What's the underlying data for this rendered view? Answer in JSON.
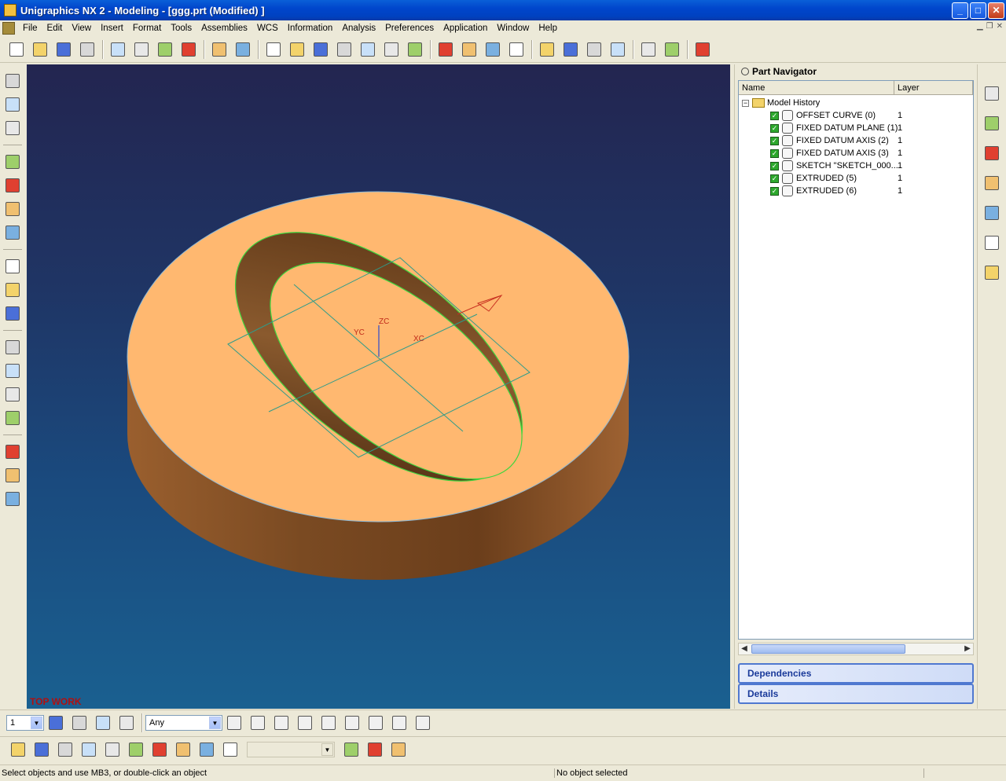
{
  "window": {
    "title": "Unigraphics NX 2 - Modeling - [ggg.prt (Modified) ]",
    "min": "_",
    "max": "□",
    "close": "✕"
  },
  "menu": [
    "File",
    "Edit",
    "View",
    "Insert",
    "Format",
    "Tools",
    "Assemblies",
    "WCS",
    "Information",
    "Analysis",
    "Preferences",
    "Application",
    "Window",
    "Help"
  ],
  "toolbar1": [
    "new-icon",
    "open-icon",
    "save-icon",
    "print-icon",
    "cut-icon",
    "copy-icon",
    "paste-icon",
    "delete-icon",
    "undo-icon",
    "repeat-command-icon",
    "fit-icon",
    "zoom-window-icon",
    "zoom-region-icon",
    "zoom-icon",
    "rotate-icon",
    "pan-icon",
    "perspective-icon",
    "wireframe-view-icon",
    "shaded-view-icon",
    "color-edit-icon",
    "render-style-icon",
    "layer-settings-icon",
    "shaded-cad-icon",
    "drafting-icon",
    "sheet-icon",
    "snap-view-icon",
    "object-display-icon",
    "class-select-icon"
  ],
  "left_toolbar": [
    "sketch-icon",
    "extrude-icon",
    "revolve-icon",
    "hole-icon",
    "boss-icon",
    "pocket-icon",
    "pad-icon",
    "datum-plane-icon",
    "datum-axis-icon",
    "datum-csys-icon",
    "block-icon",
    "cylinder-icon",
    "cone-icon",
    "sphere-icon",
    "edge-blend-icon",
    "chamfer-icon",
    "shell-icon"
  ],
  "viewport": {
    "view_label": "TOP WORK",
    "wcs": {
      "x": "XC",
      "y": "YC",
      "z": "ZC"
    }
  },
  "navigator": {
    "title": "Part Navigator",
    "columns": {
      "name": "Name",
      "layer": "Layer"
    },
    "root": "Model History",
    "items": [
      {
        "label": "OFFSET CURVE (0)",
        "layer": "1",
        "icon": "offset-curve-icon"
      },
      {
        "label": "FIXED DATUM PLANE (1)",
        "layer": "1",
        "icon": "datum-plane-icon"
      },
      {
        "label": "FIXED DATUM AXIS (2)",
        "layer": "1",
        "icon": "datum-axis-icon"
      },
      {
        "label": "FIXED DATUM AXIS (3)",
        "layer": "1",
        "icon": "datum-axis-icon"
      },
      {
        "label": "SKETCH \"SKETCH_000...",
        "layer": "1",
        "icon": "sketch-icon"
      },
      {
        "label": "EXTRUDED (5)",
        "layer": "1",
        "icon": "extrude-icon"
      },
      {
        "label": "EXTRUDED (6)",
        "layer": "1",
        "icon": "extrude-icon"
      }
    ],
    "dependencies": "Dependencies",
    "details": "Details"
  },
  "right_strip": [
    "assembly-navigator-icon",
    "part-navigator-icon",
    "web-browser-icon",
    "training-icon",
    "help-icon",
    "history-icon",
    "roles-icon"
  ],
  "bottom1": {
    "layer_value": "1",
    "filter_value": "Any"
  },
  "bottom1_icons": [
    "layer-settings-icon",
    "wcs-icon",
    "point-constructor-icon",
    "select-icon",
    "crosshair-icon",
    "end-point-icon",
    "mid-point-icon",
    "control-point-icon",
    "intersection-icon",
    "arc-center-icon",
    "tangent-icon",
    "quadrant-icon",
    "existing-point-icon"
  ],
  "bottom2_icons": [
    "assembly-icon",
    "add-component-icon",
    "mate-icon",
    "reposition-icon",
    "replace-icon",
    "reference-set-icon",
    "wave-icon",
    "mirror-icon",
    "explode-icon",
    "clone-icon",
    "interpart-icon",
    "sequence-icon",
    "check-icon"
  ],
  "status": {
    "message": "Select objects and use MB3, or double-click an object",
    "selection": "No object selected"
  }
}
